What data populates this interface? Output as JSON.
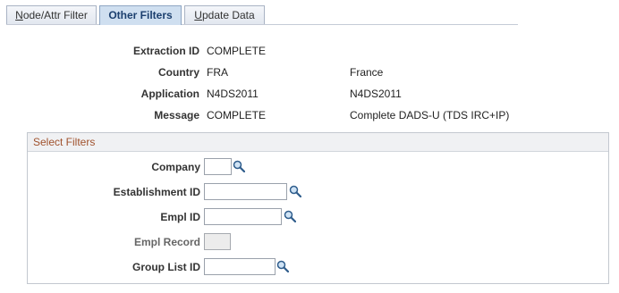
{
  "tabs": [
    {
      "label_u": "N",
      "label_rest": "ode/Attr Filter"
    },
    {
      "label": "Other Filters"
    },
    {
      "label_u": "U",
      "label_rest": "pdate Data"
    }
  ],
  "info": {
    "extraction": {
      "label": "Extraction ID",
      "value": "COMPLETE"
    },
    "country": {
      "label": "Country",
      "value": "FRA",
      "desc": "France"
    },
    "application": {
      "label": "Application",
      "value": "N4DS2011",
      "desc": "N4DS2011"
    },
    "message": {
      "label": "Message",
      "value": "COMPLETE",
      "desc": "Complete DADS-U (TDS IRC+IP)"
    }
  },
  "filters": {
    "title": "Select Filters",
    "company": {
      "label": "Company",
      "value": ""
    },
    "establishment": {
      "label": "Establishment ID",
      "value": ""
    },
    "emplid": {
      "label": "Empl ID",
      "value": ""
    },
    "emplrecord": {
      "label": "Empl Record",
      "value": ""
    },
    "grouplist": {
      "label": "Group List ID",
      "value": ""
    }
  },
  "icons": {
    "lookup": "magnifier-lookup-icon"
  }
}
